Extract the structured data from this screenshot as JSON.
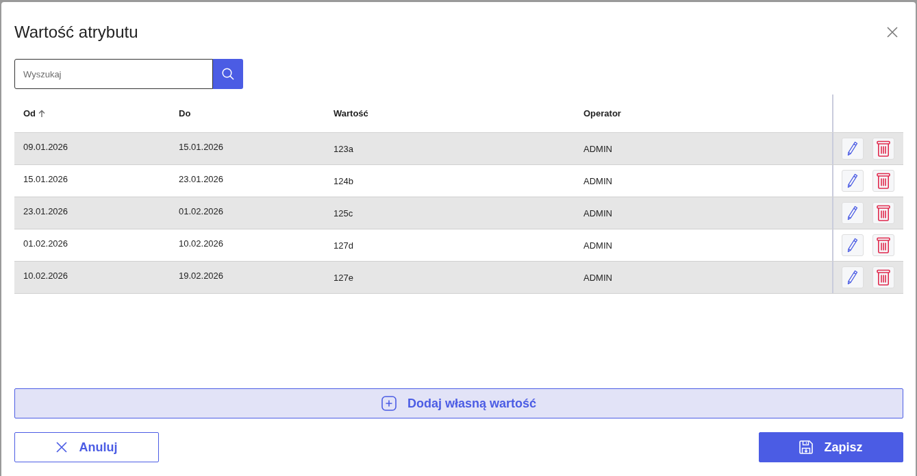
{
  "dialog": {
    "title": "Wartość atrybutu"
  },
  "search": {
    "placeholder": "Wyszukaj"
  },
  "table": {
    "columns": [
      {
        "label": "Od",
        "sorted_ascending": true
      },
      {
        "label": "Do",
        "sorted_ascending": false
      },
      {
        "label": "Wartość",
        "sorted_ascending": false
      },
      {
        "label": "Operator",
        "sorted_ascending": false
      }
    ],
    "rows": [
      {
        "cells": [
          "09.01.2026",
          "15.01.2026",
          "123a",
          "ADMIN"
        ]
      },
      {
        "cells": [
          "15.01.2026",
          "23.01.2026",
          "124b",
          "ADMIN"
        ]
      },
      {
        "cells": [
          "23.01.2026",
          "01.02.2026",
          "125c",
          "ADMIN"
        ]
      },
      {
        "cells": [
          "01.02.2026",
          "10.02.2026",
          "127d",
          "ADMIN"
        ]
      },
      {
        "cells": [
          "10.02.2026",
          "19.02.2026",
          "127e",
          "ADMIN"
        ]
      }
    ]
  },
  "add_button": {
    "label": "Dodaj własną wartość"
  },
  "buttons": [
    {
      "kind": "cancel",
      "label": "Anuluj"
    },
    {
      "kind": "save",
      "label": "Zapisz"
    }
  ]
}
